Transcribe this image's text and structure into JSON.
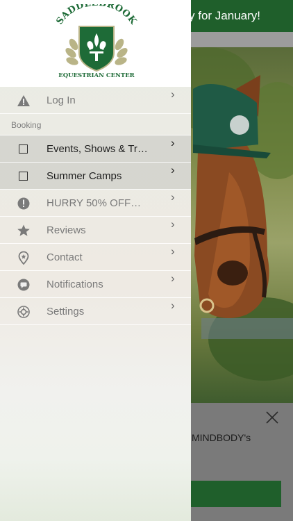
{
  "background": {
    "banner_text": "y for January!",
    "promo_text": "MINDBODY's",
    "close_icon": "close-icon",
    "colors": {
      "brand_green": "#1f5f2b"
    }
  },
  "logo": {
    "top_text": "SADDLEBROOK",
    "bottom_text": "EQUESTRIAN CENTER",
    "icon": "fleur-de-lis-shield-logo"
  },
  "menu": {
    "login": {
      "label": "Log In",
      "icon": "warning-icon"
    },
    "section_booking": "Booking",
    "events": {
      "label": "Events, Shows & Tr…",
      "icon": "checkbox-icon"
    },
    "camps": {
      "label": "Summer Camps",
      "icon": "checkbox-icon"
    },
    "promo": {
      "label": "HURRY 50% OFF…",
      "icon": "alert-circle-icon"
    },
    "reviews": {
      "label": "Reviews",
      "icon": "star-icon"
    },
    "contact": {
      "label": "Contact",
      "icon": "location-pin-icon"
    },
    "notifications": {
      "label": "Notifications",
      "icon": "chat-bubble-icon"
    },
    "settings": {
      "label": "Settings",
      "icon": "gear-icon"
    },
    "chevron": "›"
  }
}
